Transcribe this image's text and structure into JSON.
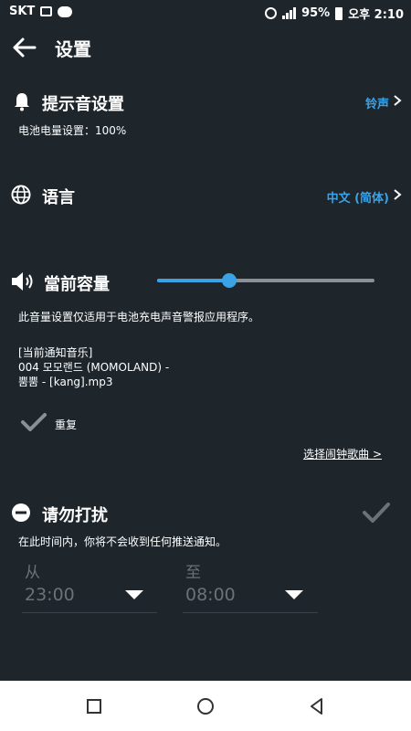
{
  "status_bar": {
    "carrier": "SKT",
    "battery": "95%",
    "time": "오후 2:10"
  },
  "header": {
    "title": "设置"
  },
  "notification_sound": {
    "title": "提示音设置",
    "value": "铃声",
    "subtitle": "电池电量设置：100%"
  },
  "language": {
    "title": "语言",
    "value": "中文 (简体)"
  },
  "volume": {
    "title": "當前容量",
    "level": 0.33,
    "description": "此音量设置仅适用于电池充电声音警报应用程序。",
    "music_line1": "[当前通知音乐]",
    "music_line2": "004 모모랜드 (MOMOLAND) -",
    "music_line3": "뿜뿜 - [kang].mp3",
    "repeat_label": "重复",
    "choose_music": "选择闹钟歌曲 >"
  },
  "do_not_disturb": {
    "title": "请勿打扰",
    "description": "在此时间内，你将不会收到任何推送通知。",
    "from_label": "从",
    "from_time": "23:00",
    "to_label": "至",
    "to_time": "08:00"
  },
  "colors": {
    "background": "#1e262c",
    "accent": "#3aa3e8",
    "disabled": "#6b7378"
  },
  "nav_icons": [
    "recents-square-icon",
    "home-circle-icon",
    "back-triangle-icon"
  ]
}
